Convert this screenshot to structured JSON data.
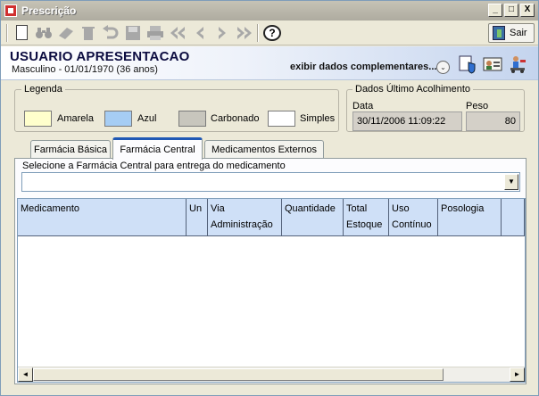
{
  "window": {
    "title": "Prescrição",
    "controls": {
      "minimize": "_",
      "maximize": "□",
      "close": "X"
    }
  },
  "toolbar": {
    "icons": [
      "new-document-icon",
      "binoculars-icon",
      "eraser-icon",
      "trash-icon",
      "undo-icon",
      "save-icon",
      "print-icon",
      "first-icon",
      "previous-icon",
      "next-icon",
      "last-icon",
      "help-icon"
    ],
    "help_glyph": "?",
    "sair_label": "Sair"
  },
  "patient": {
    "name": "USUARIO APRESENTACAO",
    "info": "Masculino - 01/01/1970 (36 anos)",
    "extra_link": "exibir dados complementares...",
    "extra_glyph": "⌄"
  },
  "legend": {
    "title": "Legenda",
    "items": [
      {
        "label": "Amarela",
        "color": "#ffffcc"
      },
      {
        "label": "Azul",
        "color": "#a6cdf4"
      },
      {
        "label": "Carbonado",
        "color": "#c8c6bd"
      },
      {
        "label": "Simples",
        "color": "#ffffff"
      }
    ]
  },
  "acolhimento": {
    "title": "Dados Último Acolhimento",
    "data_label": "Data",
    "data_value": "30/11/2006 11:09:22",
    "peso_label": "Peso",
    "peso_value": "80"
  },
  "tabs": [
    {
      "label": "Farmácia Básica",
      "active": false
    },
    {
      "label": "Farmácia Central",
      "active": true
    },
    {
      "label": "Medicamentos Externos",
      "active": false
    }
  ],
  "panel": {
    "caption": "Selecione a Farmácia Central para entrega do medicamento",
    "combo_value": "",
    "combo_arrow": "▼"
  },
  "grid": {
    "columns": [
      {
        "line1": "Medicamento",
        "line2": ""
      },
      {
        "line1": "Un",
        "line2": ""
      },
      {
        "line1": "Via",
        "line2": "Administração"
      },
      {
        "line1": "Quantidade",
        "line2": ""
      },
      {
        "line1": "Total",
        "line2": "Estoque"
      },
      {
        "line1": "Uso",
        "line2": "Contínuo"
      },
      {
        "line1": "Posologia",
        "line2": ""
      },
      {
        "line1": "",
        "line2": ""
      }
    ],
    "rows": [],
    "scroll_left": "◄",
    "scroll_right": "►"
  }
}
